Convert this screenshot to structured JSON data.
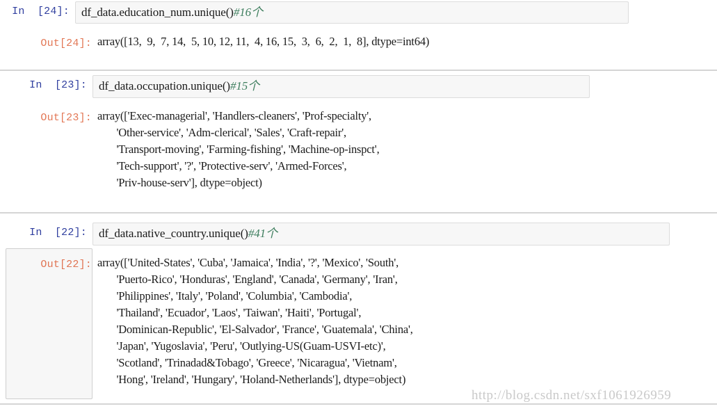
{
  "notebook": {
    "watermark": "http://blog.csdn.net/sxf1061926959",
    "colors": {
      "in_prompt": "#303f9f",
      "out_prompt": "#d84315",
      "comment": "#3f7f5f",
      "input_background": "#f7f7f7",
      "input_border": "#dcdcdc",
      "page_background": "#ffffff",
      "watermark": "#c9c9c9"
    },
    "cells": [
      {
        "in_prompt": "In  [24]:",
        "out_prompt": "Out[24]:",
        "code": "df_data.education_num.unique()",
        "comment": "#16个",
        "output_lines": [
          "array([13,  9,  7, 14,  5, 10, 12, 11,  4, 16, 15,  3,  6,  2,  1,  8], dtype=int64)"
        ]
      },
      {
        "in_prompt": "In  [23]:",
        "out_prompt": "Out[23]:",
        "code": "df_data.occupation.unique()",
        "comment": "#15个",
        "output_lines": [
          "array(['Exec-managerial', 'Handlers-cleaners', 'Prof-specialty',",
          "       'Other-service', 'Adm-clerical', 'Sales', 'Craft-repair',",
          "       'Transport-moving', 'Farming-fishing', 'Machine-op-inspct',",
          "       'Tech-support', '?', 'Protective-serv', 'Armed-Forces',",
          "       'Priv-house-serv'], dtype=object)"
        ]
      },
      {
        "in_prompt": "In  [22]:",
        "out_prompt": "Out[22]:",
        "code": "df_data.native_country.unique()",
        "comment": "#41个",
        "output_lines": [
          "array(['United-States', 'Cuba', 'Jamaica', 'India', '?', 'Mexico', 'South',",
          "       'Puerto-Rico', 'Honduras', 'England', 'Canada', 'Germany', 'Iran',",
          "       'Philippines', 'Italy', 'Poland', 'Columbia', 'Cambodia',",
          "       'Thailand', 'Ecuador', 'Laos', 'Taiwan', 'Haiti', 'Portugal',",
          "       'Dominican-Republic', 'El-Salvador', 'France', 'Guatemala', 'China',",
          "       'Japan', 'Yugoslavia', 'Peru', 'Outlying-US(Guam-USVI-etc)',",
          "       'Scotland', 'Trinadad&Tobago', 'Greece', 'Nicaragua', 'Vietnam',",
          "       'Hong', 'Ireland', 'Hungary', 'Holand-Netherlands'], dtype=object)"
        ]
      }
    ]
  }
}
